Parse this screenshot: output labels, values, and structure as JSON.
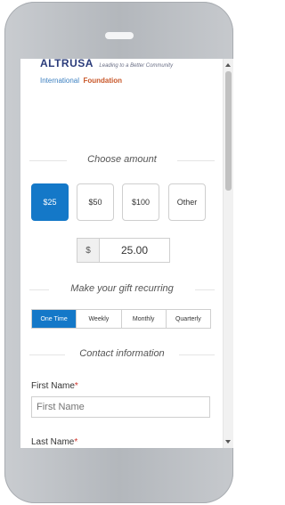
{
  "logo": {
    "brand": "ALTRUSA",
    "tagline": "Leading to a Better Community",
    "line2_a": "International",
    "line2_b": "Foundation"
  },
  "sections": {
    "amount_title": "Choose amount",
    "recurring_title": "Make your gift recurring",
    "contact_title": "Contact information"
  },
  "amounts": [
    "$25",
    "$50",
    "$100",
    "Other"
  ],
  "selected_amount_index": 0,
  "amount_field": {
    "currency": "$",
    "value": "25.00"
  },
  "frequency": [
    "One Time",
    "Weekly",
    "Monthly",
    "Quarterly"
  ],
  "selected_frequency_index": 0,
  "form": {
    "first_name_label": "First Name",
    "first_name_placeholder": "First Name",
    "last_name_label": "Last Name",
    "required_mark": "*"
  },
  "colors": {
    "accent": "#1478c8",
    "required": "#d0342c",
    "brand_navy": "#2a3b7a",
    "brand_orange": "#c85628"
  }
}
